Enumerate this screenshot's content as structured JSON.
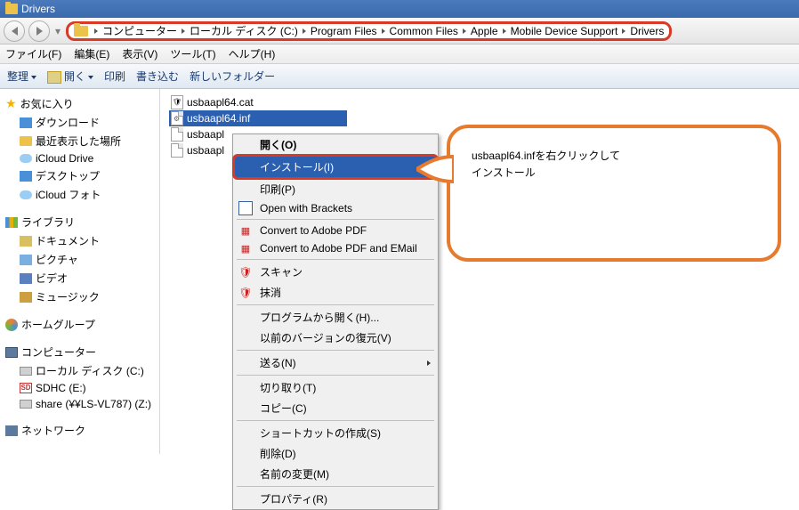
{
  "window": {
    "title": "Drivers"
  },
  "breadcrumb": [
    "コンピューター",
    "ローカル ディスク (C:)",
    "Program Files",
    "Common Files",
    "Apple",
    "Mobile Device Support",
    "Drivers"
  ],
  "menu": {
    "file": "ファイル(F)",
    "edit": "編集(E)",
    "view": "表示(V)",
    "tools": "ツール(T)",
    "help": "ヘルプ(H)"
  },
  "toolbar": {
    "organize": "整理",
    "open": "開く",
    "print": "印刷",
    "write": "書き込む",
    "newfolder": "新しいフォルダー"
  },
  "sidebar": {
    "fav": {
      "head": "お気に入り",
      "items": [
        "ダウンロード",
        "最近表示した場所",
        "iCloud Drive",
        "デスクトップ",
        "iCloud フォト"
      ]
    },
    "lib": {
      "head": "ライブラリ",
      "items": [
        "ドキュメント",
        "ピクチャ",
        "ビデオ",
        "ミュージック"
      ]
    },
    "hg": {
      "head": "ホームグループ"
    },
    "comp": {
      "head": "コンピューター",
      "items": [
        "ローカル ディスク (C:)",
        "SDHC (E:)",
        "share (¥¥LS-VL787) (Z:)"
      ]
    },
    "net": {
      "head": "ネットワーク"
    }
  },
  "files": [
    "usbaapl64.cat",
    "usbaapl64.inf",
    "usbaapl",
    "usbaapl"
  ],
  "context_menu": {
    "open": "開く(O)",
    "install": "インストール(I)",
    "print": "印刷(P)",
    "brackets": "Open with Brackets",
    "pdf1": "Convert to Adobe PDF",
    "pdf2": "Convert to Adobe PDF and EMail",
    "scan": "スキャン",
    "erase": "抹消",
    "openwith": "プログラムから開く(H)...",
    "restore": "以前のバージョンの復元(V)",
    "sendto": "送る(N)",
    "cut": "切り取り(T)",
    "copy": "コピー(C)",
    "shortcut": "ショートカットの作成(S)",
    "delete": "削除(D)",
    "rename": "名前の変更(M)",
    "props": "プロパティ(R)"
  },
  "callout": {
    "line1": "usbaapl64.infを右クリックして",
    "line2": "インストール"
  }
}
